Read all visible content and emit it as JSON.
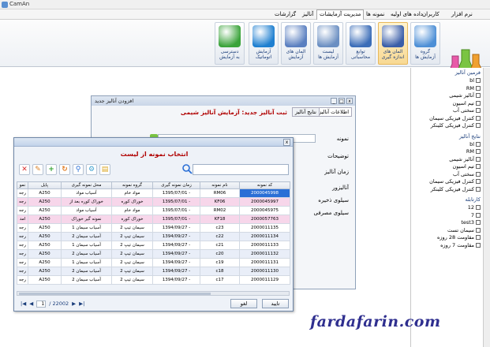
{
  "window": {
    "title": "CamAn"
  },
  "menu": {
    "items": [
      "نرم افزار",
      "کاربران",
      "داده های اولیه",
      "نمونه ها",
      "پایل ها",
      "مدیریت آزمایشات",
      "آنالیز",
      "گزارشات"
    ],
    "active_index": 5
  },
  "ribbon": {
    "buttons": [
      {
        "label1": "گروه",
        "label2": "آزمایش ها",
        "color": "#4d8fd6",
        "icon": "folder-test-icon"
      },
      {
        "label1": "المان های",
        "label2": "اندازه گیری",
        "color": "#3a5ea8",
        "icon": "atom-icon",
        "selected": true
      },
      {
        "label1": "توابع",
        "label2": "محاسباتی",
        "color": "#3b6db8",
        "icon": "function-fx-icon"
      },
      {
        "label1": "لیست",
        "label2": "آزمایش ها",
        "color": "#6b8fc2",
        "icon": "list-clock-icon"
      },
      {
        "label1": "المان های",
        "label2": "آزمایش",
        "color": "#5a7fc0",
        "icon": "document-test-icon"
      },
      {
        "label1": "آزمایش",
        "label2": "اتوماتیک",
        "color": "#1e7fd0",
        "icon": "auto-test-icon"
      },
      {
        "label1": "دسترسی",
        "label2": "به آزمایش",
        "color": "#3aa33a",
        "icon": "check-shield-icon"
      }
    ]
  },
  "side_panel": {
    "group1_title": "فرمین آنالیز",
    "group1": [
      {
        "label": "bl",
        "checked": false
      },
      {
        "label": "RM",
        "checked": false
      },
      {
        "label": "آنالیز شیمی",
        "checked": false
      },
      {
        "label": "تیم اسیون",
        "checked": false
      },
      {
        "label": "سختی آب",
        "checked": false
      },
      {
        "label": "کنترل فیزیکی سیمان",
        "checked": false
      },
      {
        "label": "کنترل فیزیکی کلینکر",
        "checked": false
      }
    ],
    "group2_title": "نتایج آنالیز",
    "group2": [
      {
        "label": "bl",
        "checked": false
      },
      {
        "label": "RM",
        "checked": false
      },
      {
        "label": "آنالیز شیمی",
        "checked": false
      },
      {
        "label": "تیم اسیون",
        "checked": false
      },
      {
        "label": "سختی آب",
        "checked": false
      },
      {
        "label": "کنترل فیزیکی سیمان",
        "checked": false
      },
      {
        "label": "کنترل فیزیکی کلینکر",
        "checked": false
      }
    ],
    "group3_title": "کارتابله",
    "group3": [
      {
        "label": "12",
        "checked": false
      },
      {
        "label": "7",
        "checked": false
      },
      {
        "label": "test3",
        "checked": false
      },
      {
        "label": "سیمان تست",
        "checked": false
      },
      {
        "label": "مقاومت 28 روزه",
        "checked": false
      },
      {
        "label": "مقاومت 7 روزه",
        "checked": false
      }
    ]
  },
  "background_window": {
    "title": "افزودن آنالیز جدید",
    "heading": "ثبت آنالیز جدید: آزمایش آنالیز شیمی",
    "tabs": [
      "اطلاعات آنالیز",
      "نتایج آنالیز"
    ],
    "fields": [
      "نمونه",
      "توضیحات",
      "زمان آنالیز",
      "آنالیزور",
      "سیلوی ذخیره",
      "سیلوی مصرفی"
    ]
  },
  "dialog": {
    "heading": "انتخاب نمونه از لیست",
    "search_placeholder": "",
    "columns": [
      "کد نمونه",
      "نام نمونه",
      "زمان نمونه گیری",
      "گروه نمونه",
      "محل نمونه گیری",
      "پایل",
      "نمو"
    ],
    "rows": [
      {
        "code": "2000045998",
        "name": "RM06",
        "time": "1395/07/01 -",
        "group": "مواد خام",
        "place": "آسیاب مواد",
        "pile": "A250",
        "n": "رجه",
        "style": "odd",
        "selected": true
      },
      {
        "code": "2000045997",
        "name": "KF06",
        "time": "1395/07/01 -",
        "group": "خوراک کوره",
        "place": "خوراک کوره بعد از",
        "pile": "A250",
        "n": "رجه",
        "style": "hl"
      },
      {
        "code": "2000045975",
        "name": "RM02",
        "time": "1395/07/01 -",
        "group": "مواد خام",
        "place": "آسیاب مواد",
        "pile": "A250",
        "n": "رجه",
        "style": "odd"
      },
      {
        "code": "2000057763",
        "name": "KF18",
        "time": "1395/07/01 -",
        "group": "خوراک کوره",
        "place": "نمونه گیر خوراک",
        "pile": "A250",
        "n": "امد",
        "style": "hl"
      },
      {
        "code": "2000011135",
        "name": "c23",
        "time": "1394/09/27 -",
        "group": "سیمان تیپ 2",
        "place": "آسیاب سیمان 1",
        "pile": "A250",
        "n": "رجه",
        "style": "odd"
      },
      {
        "code": "2000011134",
        "name": "c22",
        "time": "1394/09/27 -",
        "group": "سیمان تیپ 2",
        "place": "آسیاب سیمان 2",
        "pile": "A250",
        "n": "رجه",
        "style": "even"
      },
      {
        "code": "2000011133",
        "name": "c21",
        "time": "1394/09/27 -",
        "group": "سیمان تیپ 2",
        "place": "آسیاب سیمان 1",
        "pile": "A250",
        "n": "رجه",
        "style": "odd"
      },
      {
        "code": "2000011132",
        "name": "c20",
        "time": "1394/09/27 -",
        "group": "سیمان تیپ 2",
        "place": "آسیاب سیمان 2",
        "pile": "A250",
        "n": "رجه",
        "style": "even"
      },
      {
        "code": "2000011131",
        "name": "c19",
        "time": "1394/09/27 -",
        "group": "سیمان تیپ 2",
        "place": "آسیاب سیمان 1",
        "pile": "A250",
        "n": "رجه",
        "style": "odd"
      },
      {
        "code": "2000011130",
        "name": "c18",
        "time": "1394/09/27 -",
        "group": "سیمان تیپ 2",
        "place": "آسیاب سیمان 2",
        "pile": "A250",
        "n": "رجه",
        "style": "even"
      },
      {
        "code": "2000011129",
        "name": "c17",
        "time": "1394/09/27 -",
        "group": "سیمان تیپ 2",
        "place": "آسیاب سیمان 2",
        "pile": "A250",
        "n": "رجه",
        "style": "odd"
      }
    ],
    "pager": {
      "current": "1",
      "total": "/ 22002"
    },
    "ok_label": "تایید",
    "cancel_label": "لغو"
  },
  "watermark": "fardafarin.com",
  "colors": {
    "accent": "#2a6fd6",
    "heading": "#b00000",
    "highlight_row": "#f7d6ea"
  }
}
